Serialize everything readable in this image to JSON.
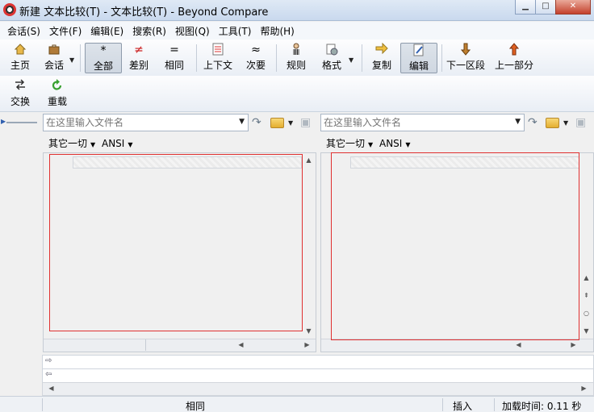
{
  "window": {
    "title": "新建 文本比较(T) - 文本比较(T) - Beyond Compare"
  },
  "menu": [
    "会话(S)",
    "文件(F)",
    "编辑(E)",
    "搜索(R)",
    "视图(Q)",
    "工具(T)",
    "帮助(H)"
  ],
  "toolbar": {
    "home": "主页",
    "session": "会话",
    "all": "全部",
    "diffs": "差别",
    "same": "相同",
    "context": "上下文",
    "minor": "次要",
    "rules": "规则",
    "format": "格式",
    "copy": "复制",
    "edit": "编辑",
    "next_section": "下一区段",
    "prev_section": "上一部分",
    "swap": "交换",
    "reload": "重载"
  },
  "icons": {
    "all": "*",
    "diffs": "≠",
    "same": "=",
    "minor": "≈"
  },
  "left": {
    "path_placeholder": "在这里输入文件名",
    "encoding_format": "其它一切",
    "encoding": "ANSI"
  },
  "right": {
    "path_placeholder": "在这里输入文件名",
    "encoding_format": "其它一切",
    "encoding": "ANSI"
  },
  "status": {
    "center": "相同",
    "mode": "插入",
    "load_time": "加载时间: 0.11 秒"
  },
  "colors": {
    "selection_border": "#e03030",
    "diffs_icon": "#cc2222",
    "accent": "#3060b0"
  }
}
